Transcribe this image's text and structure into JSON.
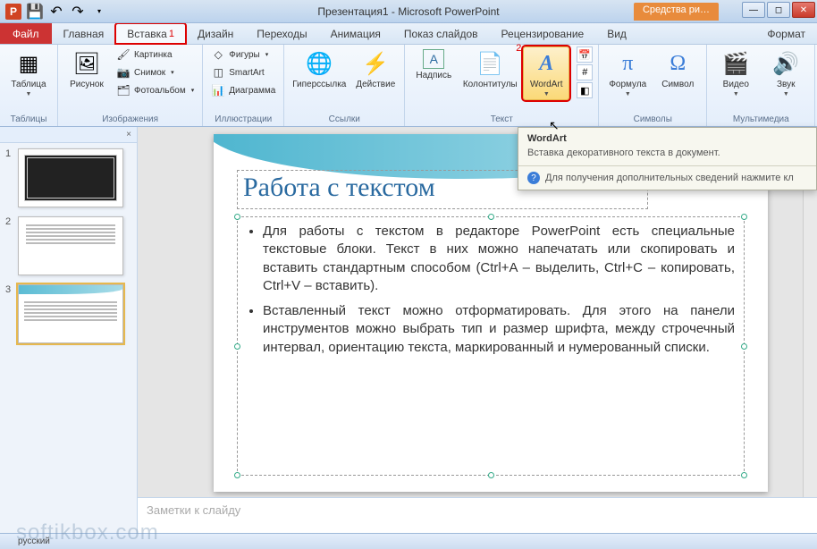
{
  "title": "Презентация1 - Microsoft PowerPoint",
  "context_tab": "Средства ри…",
  "file_tab": "Файл",
  "menu_tabs": [
    "Главная",
    "Вставка",
    "Дизайн",
    "Переходы",
    "Анимация",
    "Показ слайдов",
    "Рецензирование",
    "Вид",
    "Формат"
  ],
  "active_menu_index": 1,
  "highlight": {
    "menu_index": 1,
    "num1": "1",
    "button": "wordart",
    "num2": "2"
  },
  "ribbon": {
    "groups": {
      "tables": {
        "label": "Таблицы",
        "btn": "Таблица"
      },
      "images": {
        "label": "Изображения",
        "btn": "Рисунок",
        "small": [
          "Картинка",
          "Снимок",
          "Фотоальбом"
        ]
      },
      "illus": {
        "label": "Иллюстрации",
        "small": [
          "Фигуры",
          "SmartArt",
          "Диаграмма"
        ]
      },
      "links": {
        "label": "Ссылки",
        "b1": "Гиперссылка",
        "b2": "Действие"
      },
      "text": {
        "label": "Текст",
        "b1": "Надпись",
        "b2": "Колонтитулы",
        "b3": "WordArt"
      },
      "symbols": {
        "label": "Символы",
        "b1": "Формула",
        "b2": "Символ"
      },
      "media": {
        "label": "Мультимедиа",
        "b1": "Видео",
        "b2": "Звук"
      }
    }
  },
  "tooltip": {
    "title": "WordArt",
    "body": "Вставка декоративного текста в документ.",
    "foot": "Для получения дополнительных сведений нажмите кл"
  },
  "thumbs": [
    "1",
    "2",
    "3"
  ],
  "slide": {
    "title": "Работа с текстом",
    "bullets": [
      "Для работы с текстом в редакторе PowerPoint есть специальные текстовые блоки. Текст в них можно напечатать или скопировать и вставить стандартным способом (Ctrl+A – выделить, Ctrl+C – копировать, Ctrl+V – вставить).",
      "Вставленный текст можно отформатировать. Для этого на панели инструментов можно выбрать тип и размер шрифта, между строчечный интервал, ориентацию текста, маркированный и нумерованный списки."
    ]
  },
  "notes_placeholder": "Заметки к слайду",
  "status": {
    "lang": "русский"
  },
  "watermark": "softikbox.com"
}
